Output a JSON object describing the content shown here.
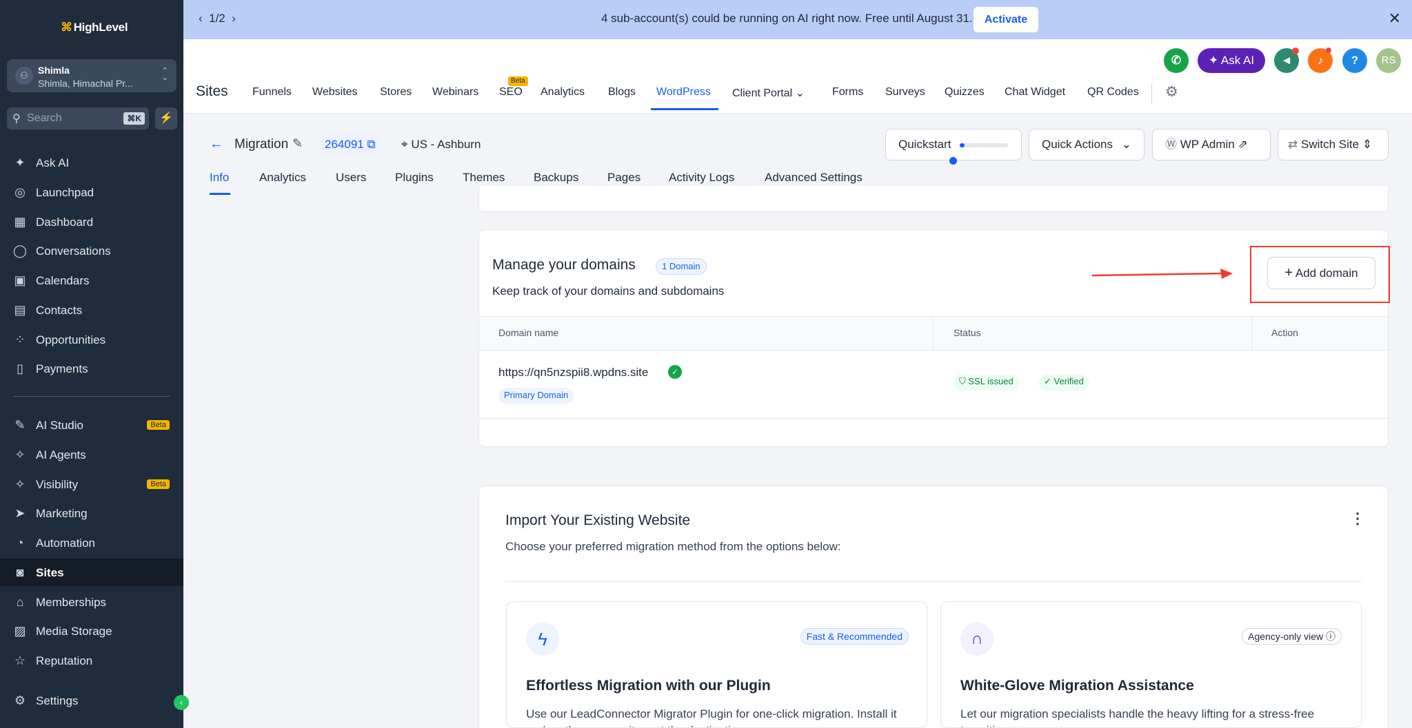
{
  "sidebar": {
    "logo": "HighLevel",
    "account": {
      "name": "Shimla",
      "location": "Shimla, Himachal Pr..."
    },
    "search": {
      "placeholder": "Search",
      "shortcut": "⌘K"
    },
    "items": [
      {
        "label": "Ask AI",
        "icon": "sparkle-icon"
      },
      {
        "label": "Launchpad",
        "icon": "rocket-icon"
      },
      {
        "label": "Dashboard",
        "icon": "grid-icon"
      },
      {
        "label": "Conversations",
        "icon": "chat-icon"
      },
      {
        "label": "Calendars",
        "icon": "calendar-icon"
      },
      {
        "label": "Contacts",
        "icon": "contacts-icon"
      },
      {
        "label": "Opportunities",
        "icon": "opportunities-icon"
      },
      {
        "label": "Payments",
        "icon": "payments-icon"
      },
      {
        "label": "AI Studio",
        "icon": "ai-studio-icon",
        "badge": "Beta"
      },
      {
        "label": "AI Agents",
        "icon": "ai-agents-icon"
      },
      {
        "label": "Visibility",
        "icon": "visibility-icon",
        "badge": "Beta"
      },
      {
        "label": "Marketing",
        "icon": "send-icon"
      },
      {
        "label": "Automation",
        "icon": "automation-icon"
      },
      {
        "label": "Sites",
        "icon": "sites-icon"
      },
      {
        "label": "Memberships",
        "icon": "memberships-icon"
      },
      {
        "label": "Media Storage",
        "icon": "image-icon"
      },
      {
        "label": "Reputation",
        "icon": "star-icon"
      },
      {
        "label": "Settings",
        "icon": "gear-icon"
      }
    ]
  },
  "banner": {
    "pager": "1/2",
    "message": "4 sub-account(s) could be running on AI right now. Free until August 31.",
    "action": "Activate"
  },
  "header": {
    "title": "Sites",
    "ask_ai": "Ask AI",
    "avatar": "RS",
    "help": "?",
    "seo_badge": "Beta",
    "tabs": [
      "Funnels",
      "Websites",
      "Stores",
      "Webinars",
      "SEO",
      "Analytics",
      "Blogs",
      "WordPress",
      "Client Portal",
      "Forms",
      "Surveys",
      "Quizzes",
      "Chat Widget",
      "QR Codes"
    ],
    "active_tab": "WordPress"
  },
  "site": {
    "name": "Migration",
    "id": "264091",
    "location": "US - Ashburn",
    "quickstart": "Quickstart",
    "quickstart_progress": 0.1,
    "quick_actions": "Quick Actions",
    "wp_admin": "WP Admin",
    "switch_site": "Switch Site",
    "tabs": [
      "Info",
      "Analytics",
      "Users",
      "Plugins",
      "Themes",
      "Backups",
      "Pages",
      "Activity Logs",
      "Advanced Settings"
    ],
    "active_tab": "Info"
  },
  "domains": {
    "title": "Manage your domains",
    "count_badge": "1 Domain",
    "subtitle": "Keep track of your domains and subdomains",
    "add_button": "Add domain",
    "columns": [
      "Domain name",
      "Status",
      "Action"
    ],
    "rows": [
      {
        "domain": "https://qn5nzspii8.wpdns.site",
        "tag": "Primary Domain",
        "ssl": "SSL issued",
        "verified": "Verified"
      }
    ]
  },
  "import": {
    "title": "Import Your Existing Website",
    "subtitle": "Choose your preferred migration method from the options below:",
    "methods": [
      {
        "badge": "Fast & Recommended",
        "title": "Effortless Migration with our Plugin",
        "desc": "Use our LeadConnector Migrator Plugin for one-click migration. Install it and on the source site, get the destination..."
      },
      {
        "badge": "Agency-only view",
        "title": "White-Glove Migration Assistance",
        "desc": "Let our migration specialists handle the heavy lifting for a stress-free transition."
      }
    ]
  },
  "colors": {
    "accent": "#155eef",
    "sidebar": "#1f2c3c",
    "highlight": "#ef3b2c",
    "success": "#16a34a"
  }
}
